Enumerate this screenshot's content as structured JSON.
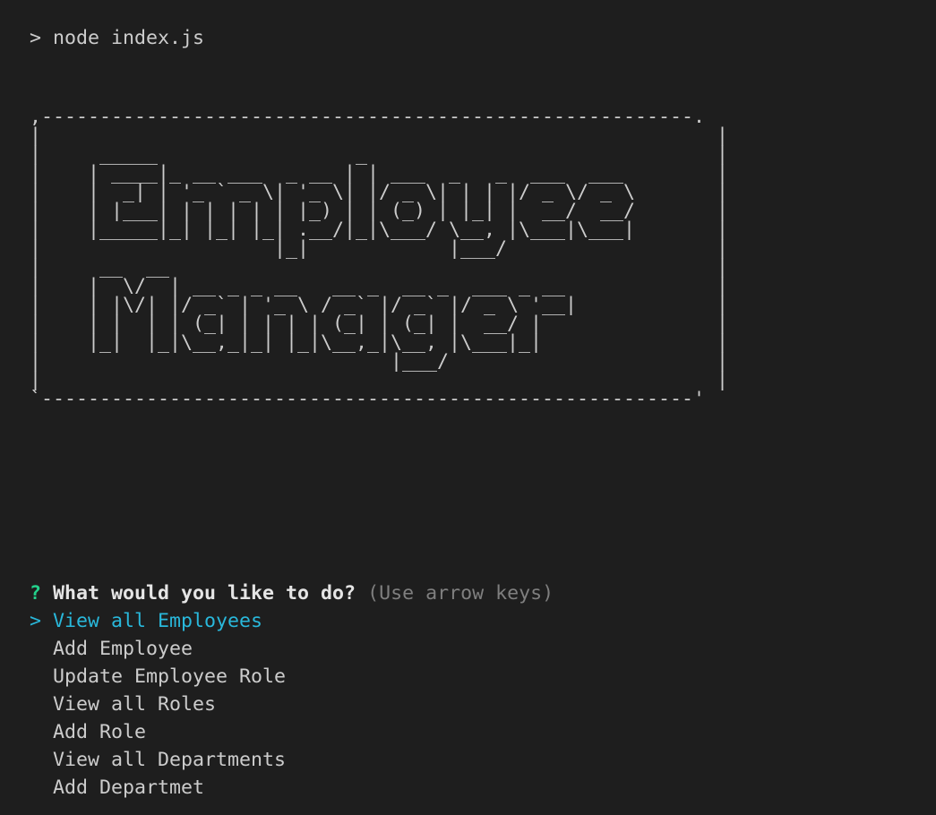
{
  "terminal": {
    "command_prompt": ">",
    "command": "node index.js",
    "banner_lines": [
      ",--------------------------------------------------------.",
      "|                                                          |",
      "|     _____                 _                              |",
      "|    | ____|_ __ ___  _ __ | | ___  _   _  ___  ___        |",
      "|    |  _| | '_ ` _ \\| '_ \\| |/ _ \\| | | |/ _ \\/ _ \\       |",
      "|    | |___| | | | | | |_) | | (_) | |_| |  __/  __/       |",
      "|    |_____|_| |_| |_| .__/|_|\\___/ \\__, |\\___|\\___|       |",
      "|                    |_|            |___/                  |",
      "|     __  __                                               |",
      "|    |  \\/  | __ _ _ __   __ _  __ _  ___ _ __             |",
      "|    | |\\/| |/ _` | '_ \\ / _` |/ _` |/ _ \\ '__|            |",
      "|    | |  | | (_| | | | | (_| | (_| |  __/ |               |",
      "|    |_|  |_|\\__,_|_| |_|\\__,_|\\__, |\\___|_|               |",
      "|                              |___/                       |",
      "|                                                          |",
      "`--------------------------------------------------------'"
    ],
    "question_mark": "?",
    "question": "What would you like to do?",
    "hint": "(Use arrow keys)",
    "selected_pointer": ">",
    "choices": [
      "View all Employees",
      "Add Employee",
      "Update Employee Role",
      "View all Roles",
      "Add Role",
      "View all Departments",
      "Add Departmet"
    ]
  }
}
